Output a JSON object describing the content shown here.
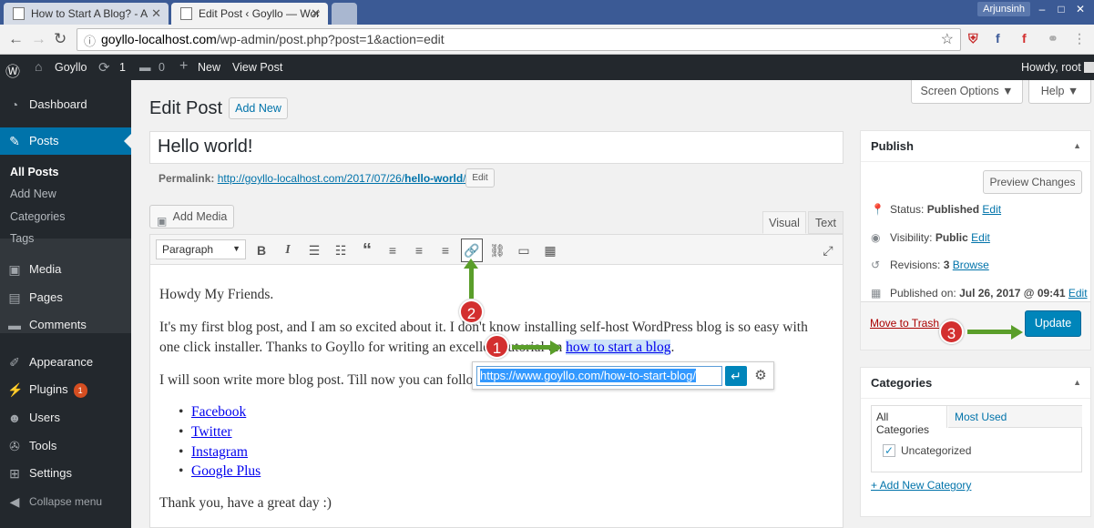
{
  "browser": {
    "tabs": [
      {
        "label": "How to Start A Blog? - A"
      },
      {
        "label": "Edit Post ‹ Goyllo — Wor"
      }
    ],
    "user_badge": "Arjunsinh",
    "url_domain": "goyllo-localhost.com",
    "url_path": "/wp-admin/post.php?post=1&action=edit"
  },
  "adminbar": {
    "site_name": "Goyllo",
    "updates_count": "1",
    "comments_count": "0",
    "new_label": "New",
    "view_post_label": "View Post",
    "howdy": "Howdy, root"
  },
  "sidebar": {
    "items": [
      {
        "label": "Dashboard",
        "icon": "dashboard-icon"
      },
      {
        "label": "Posts",
        "icon": "pin-icon"
      },
      {
        "label": "Media",
        "icon": "media-icon"
      },
      {
        "label": "Pages",
        "icon": "pages-icon"
      },
      {
        "label": "Comments",
        "icon": "comments-icon"
      },
      {
        "label": "Appearance",
        "icon": "brush-icon"
      },
      {
        "label": "Plugins",
        "icon": "plugin-icon",
        "badge": "1"
      },
      {
        "label": "Users",
        "icon": "users-icon"
      },
      {
        "label": "Tools",
        "icon": "wrench-icon"
      },
      {
        "label": "Settings",
        "icon": "settings-icon"
      },
      {
        "label": "Collapse menu",
        "icon": "collapse-icon"
      }
    ],
    "posts_submenu": [
      "All Posts",
      "Add New",
      "Categories",
      "Tags"
    ]
  },
  "header": {
    "title": "Edit Post",
    "add_new": "Add New",
    "screen_options": "Screen Options ▼",
    "help": "Help ▼"
  },
  "post": {
    "title": "Hello world!",
    "permalink_label": "Permalink:",
    "permalink_base": "http://goyllo-localhost.com/2017/07/26/",
    "permalink_slug": "hello-world",
    "permalink_end": "/",
    "permalink_edit": "Edit"
  },
  "editor": {
    "add_media": "Add Media",
    "tab_visual": "Visual",
    "tab_text": "Text",
    "format_select": "Paragraph",
    "p1": "Howdy My Friends.",
    "p2a": "It's my first blog post, and I am so excited about it. I don't know installing self-host WordPress blog is so easy with",
    "p2b": "one click installer. Thanks to Goyllo for writing an excellent tutorial on",
    "p2_link": "how to start a blog",
    "p3": "I will soon write more blog post. Till now you can follo",
    "list": [
      "Facebook",
      "Twitter",
      "Instagram",
      "Google Plus"
    ],
    "p4": "Thank you, have a great day :)",
    "link_url": "https://www.goyllo.com/how-to-start-blog/"
  },
  "publish": {
    "title": "Publish",
    "preview": "Preview Changes",
    "status_label": "Status:",
    "status_value": "Published",
    "visibility_label": "Visibility:",
    "visibility_value": "Public",
    "revisions_label": "Revisions:",
    "revisions_value": "3",
    "revisions_link": "Browse",
    "published_label": "Published on:",
    "published_value": "Jul 26, 2017 @ 09:41",
    "edit": "Edit",
    "trash": "Move to Trash",
    "update": "Update"
  },
  "categories": {
    "title": "Categories",
    "tab_all": "All Categories",
    "tab_used": "Most Used",
    "items": [
      {
        "label": "Uncategorized",
        "checked": true
      }
    ],
    "add_new": "+ Add New Category"
  },
  "annotations": [
    "1",
    "2",
    "3"
  ],
  "colors": {
    "wp_blue": "#0073aa",
    "admin_dark": "#23282d",
    "annotation_red": "#d32f2f",
    "arrow_green": "#5a9e2a"
  }
}
